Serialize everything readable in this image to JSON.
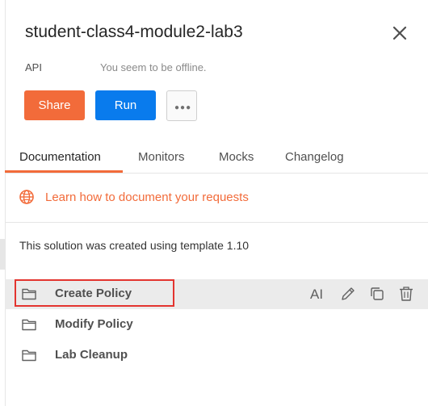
{
  "header": {
    "title": "student-class4-module2-lab3",
    "close_icon": "close-icon"
  },
  "meta": {
    "api_label": "API",
    "status_text": "You seem to be offline."
  },
  "actions": {
    "share_label": "Share",
    "run_label": "Run",
    "more_icon": "more-options-icon"
  },
  "tabs": [
    {
      "label": "Documentation",
      "active": true
    },
    {
      "label": "Monitors",
      "active": false
    },
    {
      "label": "Mocks",
      "active": false
    },
    {
      "label": "Changelog",
      "active": false
    }
  ],
  "learn": {
    "link_text": "Learn how to document your requests",
    "icon": "globe-icon"
  },
  "description": "This solution was created using template 1.10",
  "folders": [
    {
      "name": "Create Policy",
      "hovered": true,
      "highlighted": true
    },
    {
      "name": "Modify Policy",
      "hovered": false,
      "highlighted": false
    },
    {
      "name": "Lab Cleanup",
      "hovered": false,
      "highlighted": false
    }
  ],
  "row_actions": {
    "rename_glyph": "AI",
    "icons": [
      "rename-icon",
      "edit-pencil-icon",
      "duplicate-icon",
      "delete-trash-icon"
    ]
  },
  "colors": {
    "accent_orange": "#f26b3a",
    "run_blue": "#097bed",
    "highlight_red": "#e3342f",
    "hover_gray": "#ebebeb"
  }
}
